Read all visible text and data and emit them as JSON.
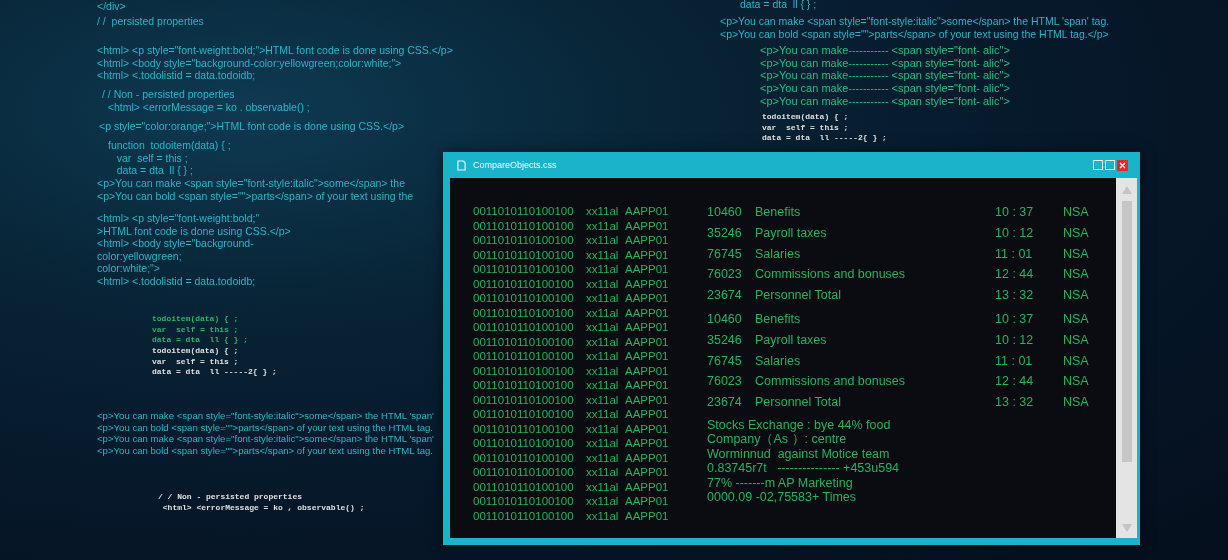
{
  "background_code": [
    {
      "kind": "code",
      "lines": [
        "</div>"
      ]
    },
    {
      "kind": "code",
      "lines": [
        "/ /  persisted properties"
      ]
    },
    {
      "kind": "code",
      "lines": [
        "<html> <p style=\"font-weight:bold;\">HTML font code is done using CSS.</p>",
        "<html> <body style=\"background-color:yellowgreen;color:white;\">",
        "<html> <.todolistid = data.todoidb;"
      ]
    },
    {
      "kind": "code",
      "lines": [
        "/ / Non - persisted properties",
        "  <html> <errorMessage = ko . observable() ;"
      ]
    },
    {
      "kind": "code",
      "lines": [
        "<p style=\"color:orange;\">HTML font code is done using CSS.</p>"
      ]
    },
    {
      "kind": "code",
      "lines": [
        "function  todoitem(data) { ;",
        "   var  self = this ;",
        "   data = dta  ll { } ;"
      ]
    },
    {
      "kind": "code",
      "lines": [
        "<p>You can make <span style=\"font-style:italic\">some</span> the",
        "<p>You can bold <span style=\"\">parts</span> of your text using the"
      ]
    },
    {
      "kind": "code",
      "lines": [
        "<html> <p style=\"font-weight:bold;\"",
        ">HTML font code is done using CSS.</p>",
        "<html> <body style=\"background-",
        "color:yellowgreen;",
        "color:white;\">",
        "<html> <.todolistid = data.todoidb;"
      ]
    },
    {
      "kind": "mono-green",
      "lines": [
        "todoitem(data) { ;",
        "var  self = this ;",
        "data = dta  ll { } ;"
      ]
    },
    {
      "kind": "mono-white",
      "lines": [
        "todoitem(data) { ;",
        "var  self = this ;",
        "data = dta  ll -----2{ } ;"
      ]
    },
    {
      "kind": "code",
      "lines": [
        "<p>You can make <span style=\"font-style:italic\">some</span> the HTML 'span'",
        "<p>You can bold <span style=\"\">parts</span> of your text using the HTML tag.",
        "<p>You can make <span style=\"font-style:italic\">some</span> the HTML 'span'",
        "<p>You can bold <span style=\"\">parts</span> of your text using the HTML tag."
      ]
    },
    {
      "kind": "mono-white",
      "lines": [
        "/ / Non - persisted properties",
        " <html> <errorMessage = ko , observable() ;"
      ]
    },
    {
      "kind": "code",
      "lines": [
        "data = dta  ll { } ;"
      ]
    },
    {
      "kind": "code",
      "lines": [
        "<p>You can make <span style=\"font-style:italic\">some</span> the HTML 'span' tag.",
        "<p>You can bold <span style=\"\">parts</span> of your text using the HTML tag.</p>"
      ]
    },
    {
      "kind": "markup-green",
      "lines": [
        "<p>You can make----------- <span style=\"font- alic\">",
        "<p>You can make----------- <span style=\"font- alic\">",
        "<p>You can make----------- <span style=\"font- alic\">",
        "<p>You can make----------- <span style=\"font- alic\">",
        "<p>You can make----------- <span style=\"font- alic\">"
      ]
    },
    {
      "kind": "mono-white",
      "lines": [
        "todoitem(data) { ;",
        "var  self = this ;",
        "data = dta  ll -----2{ } ;"
      ]
    }
  ],
  "window": {
    "title": "CompareObjects.css",
    "binary_rows": [
      {
        "bits": "0011010110100100",
        "code": "xx11al",
        "id": "AAPP01"
      },
      {
        "bits": "0011010110100100",
        "code": "xx11al",
        "id": "AAPP01"
      },
      {
        "bits": "0011010110100100",
        "code": "xx11al",
        "id": "AAPP01"
      },
      {
        "bits": "0011010110100100",
        "code": "xx11al",
        "id": "AAPP01"
      },
      {
        "bits": "0011010110100100",
        "code": "xx11al",
        "id": "AAPP01"
      },
      {
        "bits": "0011010110100100",
        "code": "xx11al",
        "id": "AAPP01"
      },
      {
        "bits": "0011010110100100",
        "code": "xx11al",
        "id": "AAPP01"
      },
      {
        "bits": "0011010110100100",
        "code": "xx11al",
        "id": "AAPP01"
      },
      {
        "bits": "0011010110100100",
        "code": "xx11al",
        "id": "AAPP01"
      },
      {
        "bits": "0011010110100100",
        "code": "xx11al",
        "id": "AAPP01"
      },
      {
        "bits": "0011010110100100",
        "code": "xx11al",
        "id": "AAPP01"
      },
      {
        "bits": "0011010110100100",
        "code": "xx11al",
        "id": "AAPP01"
      },
      {
        "bits": "0011010110100100",
        "code": "xx11al",
        "id": "AAPP01"
      },
      {
        "bits": "0011010110100100",
        "code": "xx11al",
        "id": "AAPP01"
      },
      {
        "bits": "0011010110100100",
        "code": "xx11al",
        "id": "AAPP01"
      },
      {
        "bits": "0011010110100100",
        "code": "xx11al",
        "id": "AAPP01"
      },
      {
        "bits": "0011010110100100",
        "code": "xx11al",
        "id": "AAPP01"
      },
      {
        "bits": "0011010110100100",
        "code": "xx11al",
        "id": "AAPP01"
      },
      {
        "bits": "0011010110100100",
        "code": "xx11al",
        "id": "AAPP01"
      },
      {
        "bits": "0011010110100100",
        "code": "xx11al",
        "id": "AAPP01"
      },
      {
        "bits": "0011010110100100",
        "code": "xx11al",
        "id": "AAPP01"
      },
      {
        "bits": "0011010110100100",
        "code": "xx11al",
        "id": "AAPP01"
      }
    ],
    "record_groups": [
      [
        {
          "number": "10460",
          "label": "Benefits",
          "time": "10  : 37",
          "status": "NSA"
        },
        {
          "number": "35246",
          "label": "Payroll taxes",
          "time": "10 : 12",
          "status": "NSA"
        },
        {
          "number": "76745",
          "label": "Salaries",
          "time": "11 : 01",
          "status": "NSA"
        },
        {
          "number": "76023",
          "label": "Commissions and bonuses",
          "time": "12 : 44",
          "status": "NSA"
        },
        {
          "number": "23674",
          "label": "Personnel Total",
          "time": "13 : 32",
          "status": "NSA"
        }
      ],
      [
        {
          "number": "10460",
          "label": "Benefits",
          "time": "10  : 37",
          "status": "NSA"
        },
        {
          "number": "35246",
          "label": "Payroll taxes",
          "time": "10 : 12",
          "status": "NSA"
        },
        {
          "number": "76745",
          "label": "Salaries",
          "time": "11 : 01",
          "status": "NSA"
        },
        {
          "number": "76023",
          "label": "Commissions and bonuses",
          "time": "12 : 44",
          "status": "NSA"
        },
        {
          "number": "23674",
          "label": "Personnel Total",
          "time": "13 : 32",
          "status": "NSA"
        }
      ]
    ],
    "notes": [
      "Stocks Exchange : bye 44% food",
      "Company（As ）: centre",
      "Worminnud  against Motice team",
      "0.83745r7t   --------------- +453u594",
      "77% -------m AP Marketing",
      "0000.09 -02,75583+ Times"
    ]
  }
}
